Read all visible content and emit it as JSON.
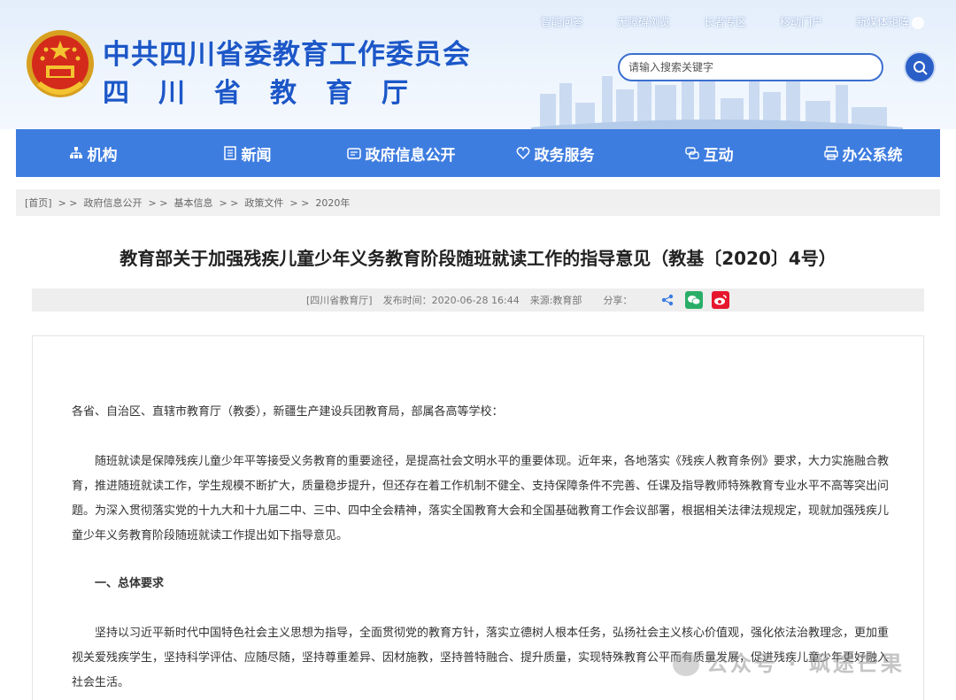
{
  "header": {
    "org_name": "中共四川省委教育工作委员会",
    "dept_name": "四川省教育厅",
    "top_links": [
      "智能问答",
      "无障碍浏览",
      "长者专区",
      "移动门户",
      "新媒体矩阵"
    ],
    "search_placeholder": "请输入搜索关键字"
  },
  "nav": {
    "items": [
      {
        "label": "机构",
        "icon": "org-icon"
      },
      {
        "label": "新闻",
        "icon": "news-icon"
      },
      {
        "label": "政府信息公开",
        "icon": "info-icon"
      },
      {
        "label": "政务服务",
        "icon": "service-icon"
      },
      {
        "label": "互动",
        "icon": "interact-icon"
      },
      {
        "label": "办公系统",
        "icon": "office-icon"
      }
    ]
  },
  "breadcrumb": {
    "items": [
      "[首页]",
      "政府信息公开",
      "基本信息",
      "政策文件",
      "2020年"
    ],
    "separator": "> >"
  },
  "article": {
    "title": "教育部关于加强残疾儿童少年义务教育阶段随班就读工作的指导意见（教基〔2020〕4号）",
    "source_tag": "[四川省教育厅]",
    "publish_time": "发布时间：2020-06-28 16:44",
    "origin": "来源:教育部",
    "share_label": "分享：",
    "para1": "各省、自治区、直辖市教育厅（教委），新疆生产建设兵团教育局，部属各高等学校：",
    "para2": "随班就读是保障残疾儿童少年平等接受义务教育的重要途径，是提高社会文明水平的重要体现。近年来，各地落实《残疾人教育条例》要求，大力实施融合教育，推进随班就读工作，学生规模不断扩大，质量稳步提升，但还存在着工作机制不健全、支持保障条件不完善、任课及指导教师特殊教育专业水平不高等突出问题。为深入贯彻落实党的十九大和十九届二中、三中、四中全会精神，落实全国教育大会和全国基础教育工作会议部署，根据相关法律法规规定，现就加强残疾儿童少年义务教育阶段随班就读工作提出如下指导意见。",
    "heading1": "一、总体要求",
    "para3": "坚持以习近平新时代中国特色社会主义思想为指导，全面贯彻党的教育方针，落实立德树人根本任务，弘扬社会主义核心价值观，强化依法治教理念，更加重视关爱残疾学生，坚持科学评估、应随尽随，坚持尊重差异、因材施教，坚持普特融合、提升质量，实现特殊教育公平而有质量发展，促进残疾儿童少年更好融入社会生活。"
  },
  "watermark": "公众号 · 飒途芒果",
  "colors": {
    "brand_blue": "#1c57c8",
    "nav_blue": "#3e7de0",
    "wechat_green": "#2aae67",
    "weibo_red": "#e6162d",
    "share_blue": "#3a7be0"
  }
}
